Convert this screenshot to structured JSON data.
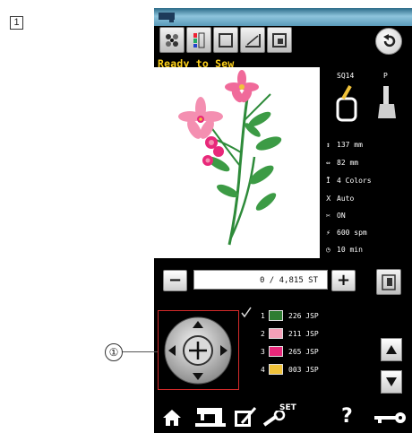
{
  "figure_label": "1",
  "callout_label": "①",
  "status": {
    "text": "Ready to Sew"
  },
  "presser": {
    "hoop_code": "SQ14",
    "foot_code": "P"
  },
  "info": [
    {
      "icon": "height-icon",
      "glyph": "↕",
      "text": "137 mm"
    },
    {
      "icon": "width-icon",
      "glyph": "⇔",
      "text": "82 mm"
    },
    {
      "icon": "spool-icon",
      "glyph": "Ī",
      "text": "4 Colors"
    },
    {
      "icon": "jump-stitch-icon",
      "glyph": "ꓫ",
      "text": "Auto"
    },
    {
      "icon": "thread-cutter-icon",
      "glyph": "✂",
      "text": "ON"
    },
    {
      "icon": "speed-icon",
      "glyph": "⚡",
      "text": "600 spm"
    },
    {
      "icon": "clock-icon",
      "glyph": "◷",
      "text": "10 min"
    }
  ],
  "counter": {
    "minus": "−",
    "plus": "+",
    "value": "0 / 4,815 ST"
  },
  "colors": [
    {
      "num": "1",
      "swatch": "#2e7d32",
      "code": "226 JSP"
    },
    {
      "num": "2",
      "swatch": "#f4a0b8",
      "code": "211 JSP"
    },
    {
      "num": "3",
      "swatch": "#e8287a",
      "code": "265 JSP"
    },
    {
      "num": "4",
      "swatch": "#f0c23a",
      "code": "003 JSP"
    }
  ],
  "bottom": {
    "set_label": "SET",
    "help_label": "?"
  },
  "accent_colors": {
    "status": "#ffd21a",
    "callout_frame": "#d42a2a"
  }
}
